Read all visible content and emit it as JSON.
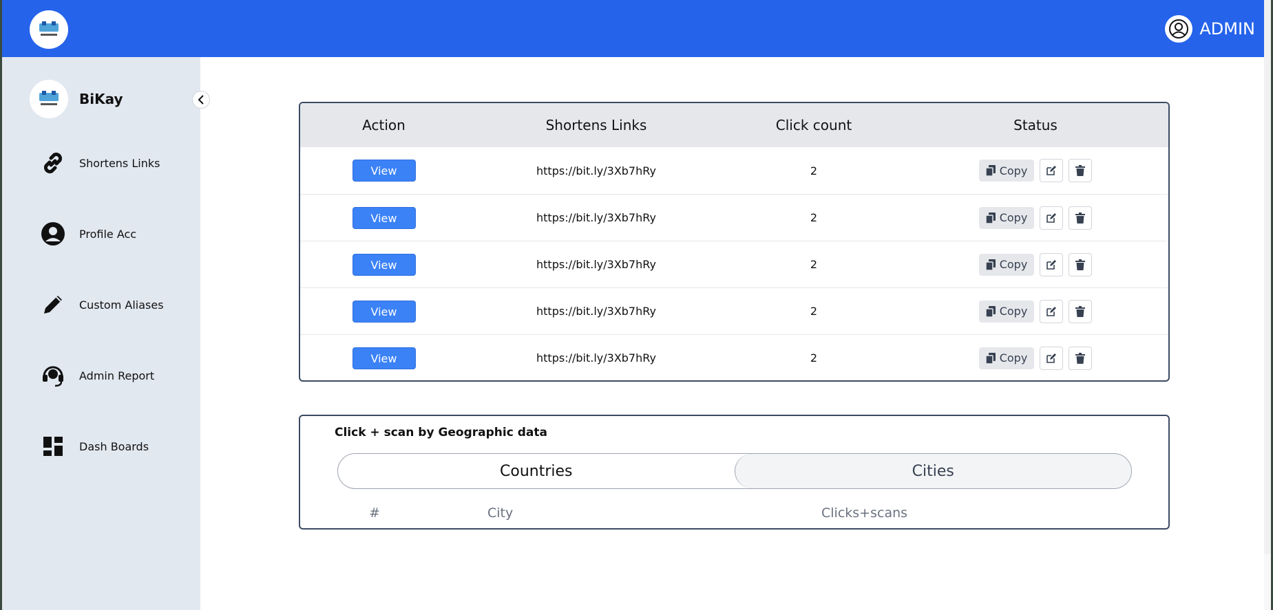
{
  "header": {
    "admin_label": "ADMIN"
  },
  "sidebar": {
    "brand_name": "BiKay",
    "items": [
      {
        "label": "Shortens Links",
        "icon": "link-icon"
      },
      {
        "label": "Profile Acc",
        "icon": "user-circle-icon"
      },
      {
        "label": "Custom Aliases",
        "icon": "pencil-icon"
      },
      {
        "label": "Admin Report",
        "icon": "headset-icon"
      },
      {
        "label": "Dash Boards",
        "icon": "dashboard-icon"
      }
    ]
  },
  "links_table": {
    "headers": {
      "action": "Action",
      "link": "Shortens Links",
      "count": "Click count",
      "status": "Status"
    },
    "view_label": "View",
    "copy_label": "Copy",
    "rows": [
      {
        "link": "https://bit.ly/3Xb7hRy",
        "count": "2"
      },
      {
        "link": "https://bit.ly/3Xb7hRy",
        "count": "2"
      },
      {
        "link": "https://bit.ly/3Xb7hRy",
        "count": "2"
      },
      {
        "link": "https://bit.ly/3Xb7hRy",
        "count": "2"
      },
      {
        "link": "https://bit.ly/3Xb7hRy",
        "count": "2"
      }
    ]
  },
  "geo": {
    "title": "Click + scan by Geographic data",
    "tabs": [
      "Countries",
      "Cities"
    ],
    "active_tab": "Cities",
    "columns": [
      "#",
      "City",
      "Clicks+scans"
    ]
  },
  "colors": {
    "primary": "#2563eb",
    "sidebar_bg": "#e2e8f0",
    "button": "#3b82f6"
  }
}
